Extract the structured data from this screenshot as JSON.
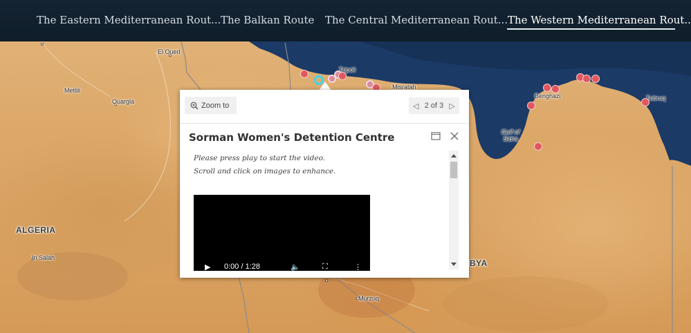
{
  "nav": {
    "tabs": [
      {
        "label": "The Eastern Mediterranean Rout..."
      },
      {
        "label": "The Balkan Route"
      },
      {
        "label": "The Central Mediterranean Rout..."
      },
      {
        "label": "The Western Mediterranean Rout..."
      }
    ],
    "active_tab_index": 3
  },
  "map": {
    "places": {
      "el_oued": "El Oued",
      "metlili": "Metlili",
      "ouargla": "Ouargla",
      "algeria": "ALGERIA",
      "in_salah": "In Salah",
      "tripoli": "Tripoli",
      "misratah": "Misratah",
      "benghazi": "Benghazi",
      "tubruq": "Tubruq",
      "gulf_of_sidra": "Gulf of Sidra",
      "libya_partial": "BYA",
      "murzuq": "Murzuq"
    },
    "colors": {
      "sea": "#1b3a66",
      "marker": "#e0585e",
      "selected_marker": "#3fd8e8"
    }
  },
  "popup": {
    "zoom_label": "Zoom to",
    "pager_text": "2 of 3",
    "title": "Sorman Women's Detention Centre",
    "intro_line1": "Please press play to start the video.",
    "intro_line2": "Scroll and click on images to enhance.",
    "video_time": "0:00 / 1:28"
  }
}
